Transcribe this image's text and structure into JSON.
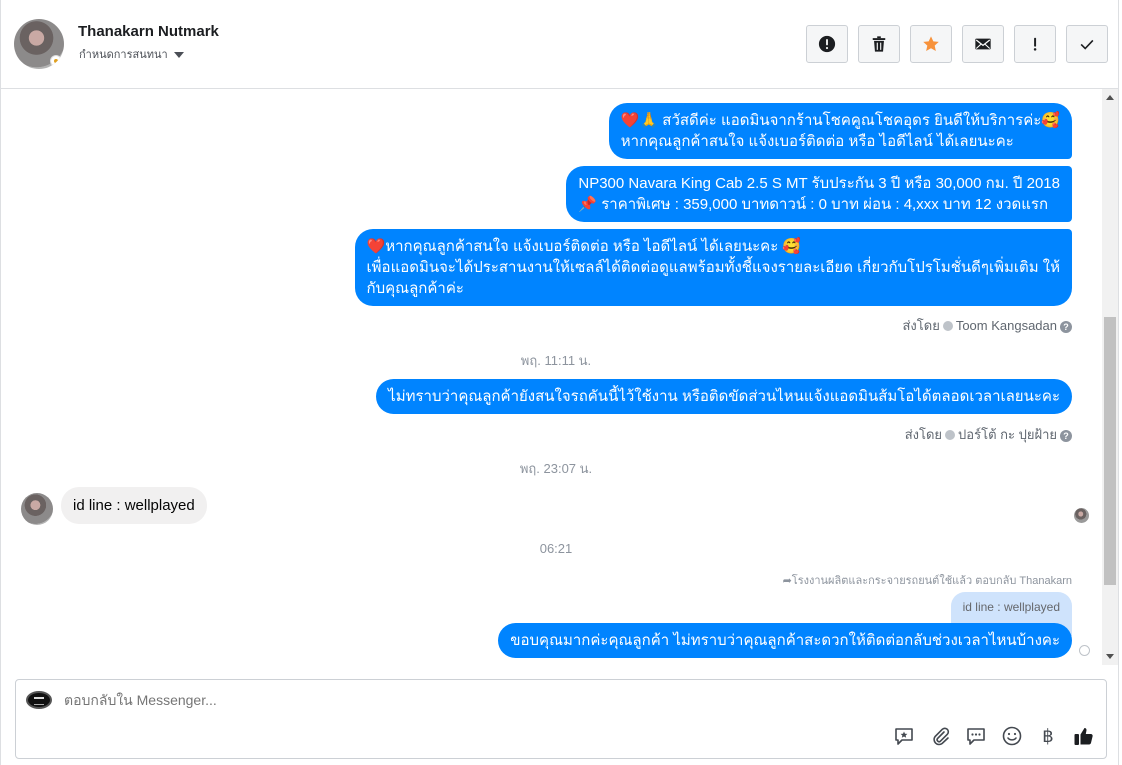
{
  "header": {
    "user_name": "Thanakarn Nutmark",
    "subtitle": "กำหนดการสนทนา",
    "toolbar": [
      {
        "name": "report-button",
        "icon": "alert-circle-icon"
      },
      {
        "name": "delete-button",
        "icon": "trash-icon"
      },
      {
        "name": "star-button",
        "icon": "star-icon"
      },
      {
        "name": "mark-unread-button",
        "icon": "envelope-icon"
      },
      {
        "name": "mark-spam-button",
        "icon": "exclamation-icon"
      },
      {
        "name": "mark-done-button",
        "icon": "check-icon"
      }
    ]
  },
  "messages": {
    "m1": {
      "line1": "❤️🙏 สวัสดีค่ะ แอดมินจากร้านโชคคูณโชคอุดร ยินดีให้บริการค่ะ🥰",
      "line2": "หากคุณลูกค้าสนใจ แจ้งเบอร์ติดต่อ หรือ ไอดีไลน์ ได้เลยนะคะ"
    },
    "m2": {
      "line1": "NP300 Navara King Cab 2.5 S MT รับประกัน 3 ปี หรือ 30,000 กม. ปี 2018",
      "line2": "📌 ราคาพิเศษ : 359,000 บาทดาวน์ : 0 บาท ผ่อน : 4,xxx บาท 12 งวดแรก"
    },
    "m3": {
      "line1": "❤️หากคุณลูกค้าสนใจ แจ้งเบอร์ติดต่อ หรือ ไอดีไลน์ ได้เลยนะคะ 🥰",
      "line2": "เพื่อแอดมินจะได้ประสานงานให้เซลล์ได้ติดต่อดูแลพร้อมทั้งชี้แจงรายละเอียด เกี่ยวกับโปรโมชั่นดีๆเพิ่มเติม ให้",
      "line3": "กับคุณลูกค้าค่ะ"
    },
    "sent_by_1": {
      "prefix": "ส่งโดย",
      "name": "Toom Kangsadan"
    },
    "time_1": "พฤ. 11:11 น.",
    "m4": "ไม่ทราบว่าคุณลูกค้ายังสนใจรถคันนี้ไว้ใช้งาน หรือติดขัดส่วนไหนแจ้งแอดมินส้มโอได้ตลอดเวลาเลยนะคะ",
    "sent_by_2": {
      "prefix": "ส่งโดย",
      "name": "ปอร์โต้ กะ ปุยฝ้าย"
    },
    "time_2": "พฤ. 23:07 น.",
    "incoming_1": "id line : wellplayed",
    "time_3": "06:21",
    "reply_note": "โรงงานผลิตและกระจายรถยนต์ใช้แล้ว ตอบกลับ Thanakarn",
    "quoted": "id line : wellplayed",
    "m5": "ขอบคุณมากค่ะคุณลูกค้า ไม่ทราบว่าคุณลูกค้าสะดวกให้ติดต่อกลับช่วงเวลาไหนบ้างคะ"
  },
  "composer": {
    "placeholder": "ตอบกลับใน Messenger...",
    "tools": [
      "saved-reply-icon",
      "paperclip-icon",
      "chat-icon",
      "emoji-icon",
      "baht-icon",
      "thumbs-up-icon"
    ],
    "baht_glyph": "฿"
  },
  "colors": {
    "outgoing_bubble": "#0084ff",
    "incoming_bubble": "#f1f0f0",
    "quoted_bubble": "#cfe3fc",
    "star": "#f7923b"
  }
}
